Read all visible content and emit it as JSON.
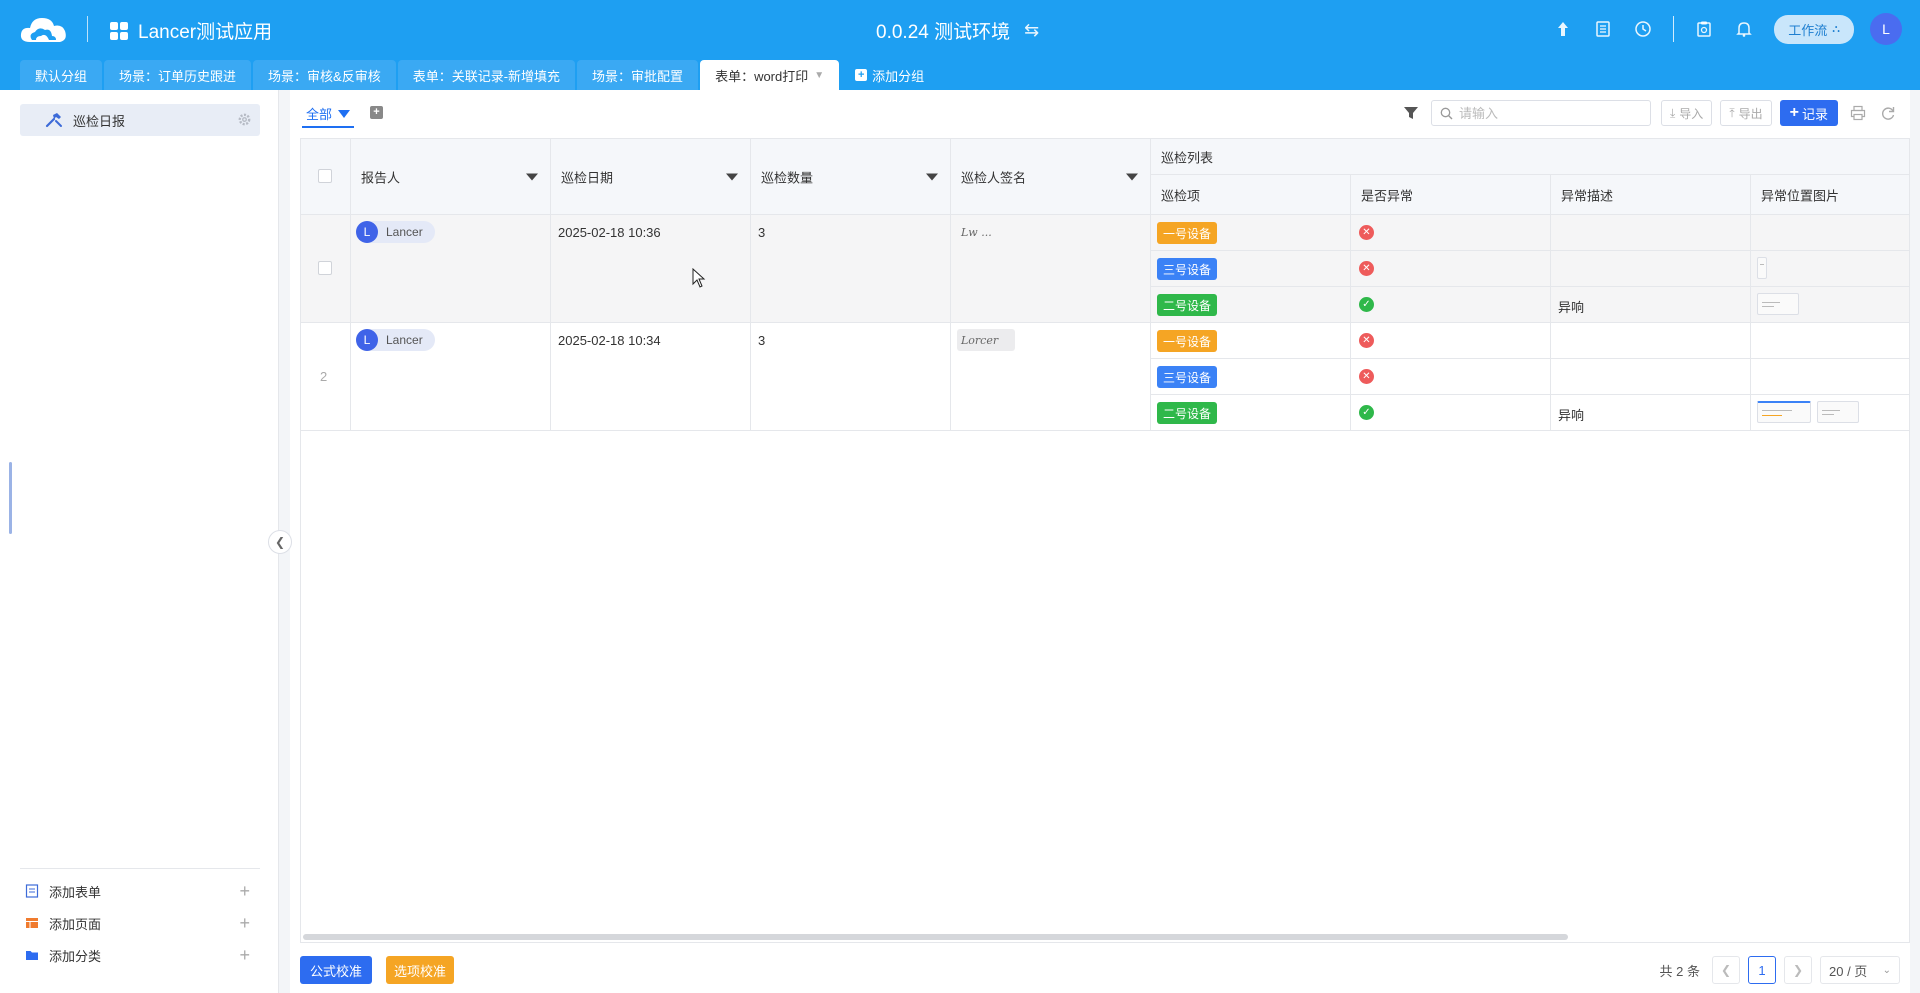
{
  "header": {
    "app_title": "Lancer测试应用",
    "env_title": "0.0.24 测试环境",
    "workflow_label": "工作流",
    "user_initial": "L"
  },
  "tabs": [
    {
      "label": "默认分组",
      "active": false
    },
    {
      "label": "场景：订单历史跟进",
      "active": false
    },
    {
      "label": "场景：审核&反审核",
      "active": false
    },
    {
      "label": "表单：关联记录-新增填充",
      "active": false
    },
    {
      "label": "场景：审批配置",
      "active": false
    },
    {
      "label": "表单：word打印",
      "active": true
    }
  ],
  "add_group_label": "添加分组",
  "sidebar": {
    "items": [
      {
        "label": "巡检日报"
      }
    ],
    "bottom": [
      {
        "label": "添加表单",
        "icon": "form-icon"
      },
      {
        "label": "添加页面",
        "icon": "page-icon"
      },
      {
        "label": "添加分类",
        "icon": "folder-icon"
      }
    ]
  },
  "view": {
    "label": "全部"
  },
  "toolbar": {
    "search_placeholder": "请输入",
    "import_label": "导入",
    "export_label": "导出",
    "add_record_label": "记录"
  },
  "table": {
    "columns": [
      {
        "label": "报告人"
      },
      {
        "label": "巡检日期"
      },
      {
        "label": "巡检数量"
      },
      {
        "label": "巡检人签名"
      }
    ],
    "group_header": "巡检列表",
    "sub_columns": [
      {
        "label": "巡检项"
      },
      {
        "label": "是否异常"
      },
      {
        "label": "异常描述"
      },
      {
        "label": "异常位置图片"
      }
    ],
    "rows": [
      {
        "row_no": "",
        "reporter": "Lancer",
        "reporter_initial": "L",
        "date": "2025-02-18 10:36",
        "count": "3",
        "signature": "Lw ...",
        "items": [
          {
            "device": "一号设备",
            "color": "#f5a524",
            "abnormal": false,
            "desc": "",
            "images": 0
          },
          {
            "device": "三号设备",
            "color": "#3b82f6",
            "abnormal": false,
            "desc": "",
            "images": 1
          },
          {
            "device": "二号设备",
            "color": "#2fb84a",
            "abnormal": true,
            "desc": "异响",
            "images": 1
          }
        ]
      },
      {
        "row_no": "2",
        "reporter": "Lancer",
        "reporter_initial": "L",
        "date": "2025-02-18 10:34",
        "count": "3",
        "signature": "Lorcer",
        "items": [
          {
            "device": "一号设备",
            "color": "#f5a524",
            "abnormal": false,
            "desc": "",
            "images": 0
          },
          {
            "device": "三号设备",
            "color": "#3b82f6",
            "abnormal": false,
            "desc": "",
            "images": 0
          },
          {
            "device": "二号设备",
            "color": "#2fb84a",
            "abnormal": true,
            "desc": "异响",
            "images": 2
          }
        ]
      }
    ]
  },
  "footer": {
    "formula_btn": "公式校准",
    "option_btn": "选项校准",
    "total": "共 2 条",
    "current_page": "1",
    "page_size": "20 / 页"
  }
}
